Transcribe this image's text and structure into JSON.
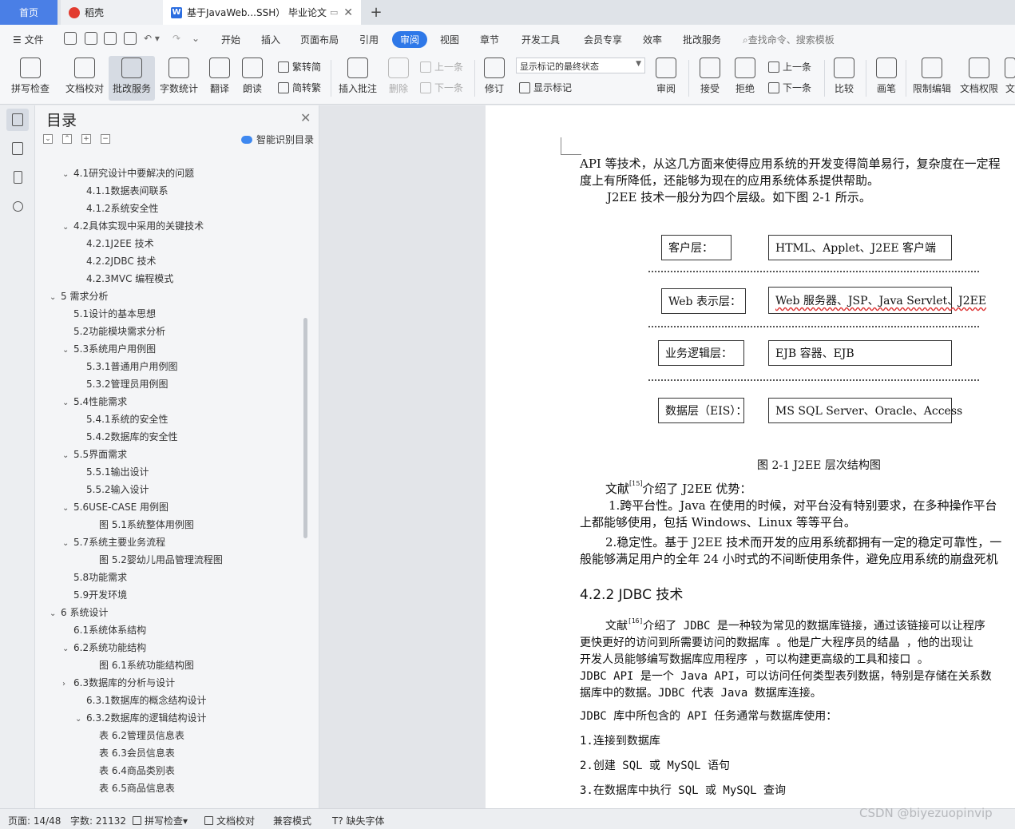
{
  "tabs": {
    "home": "首页",
    "daoke": "稻壳",
    "doc": "基于JavaWeb...SSH） 毕业论文",
    "add": "+"
  },
  "menu": {
    "file": "文件",
    "items": [
      "开始",
      "插入",
      "页面布局",
      "引用",
      "审阅",
      "视图",
      "章节",
      "开发工具",
      "会员专享",
      "效率",
      "批改服务"
    ],
    "active": "审阅",
    "search_placeholder": "查找命令、搜索模板"
  },
  "ribbon": {
    "spell": "拼写检查",
    "proof": "文档校对",
    "review_service": "批改服务",
    "word_count": "字数统计",
    "translate": "翻译",
    "read_aloud": "朗读",
    "trad": "繁转简",
    "simp": "简转繁",
    "insert_comment": "插入批注",
    "delete": "删除",
    "prev_comment": "上一条",
    "next_comment": "下一条",
    "revise": "修订",
    "markup_state": "显示标记的最终状态",
    "show_markup": "显示标记",
    "review": "审阅",
    "accept": "接受",
    "reject": "拒绝",
    "prev_change": "上一条",
    "next_change": "下一条",
    "compare": "比较",
    "pen": "画笔",
    "restrict": "限制编辑",
    "permission": "文档权限",
    "more": "文"
  },
  "toc": {
    "title": "目录",
    "smart": "智能识别目录",
    "items": [
      {
        "text": "4.1研究设计中要解决的问题",
        "level": 2,
        "caret": "expanded"
      },
      {
        "text": "4.1.1数据表间联系",
        "level": 3,
        "caret": ""
      },
      {
        "text": "4.1.2系统安全性",
        "level": 3,
        "caret": ""
      },
      {
        "text": "4.2具体实现中采用的关键技术",
        "level": 2,
        "caret": "expanded"
      },
      {
        "text": "4.2.1J2EE 技术",
        "level": 3,
        "caret": ""
      },
      {
        "text": "4.2.2JDBC 技术",
        "level": 3,
        "caret": ""
      },
      {
        "text": "4.2.3MVC 编程模式",
        "level": 3,
        "caret": ""
      },
      {
        "text": "5 需求分析",
        "level": 1,
        "caret": "expanded"
      },
      {
        "text": "5.1设计的基本思想",
        "level": 2,
        "caret": ""
      },
      {
        "text": "5.2功能模块需求分析",
        "level": 2,
        "caret": ""
      },
      {
        "text": "5.3系统用户用例图",
        "level": 2,
        "caret": "expanded"
      },
      {
        "text": "5.3.1普通用户用例图",
        "level": 3,
        "caret": ""
      },
      {
        "text": "5.3.2管理员用例图",
        "level": 3,
        "caret": ""
      },
      {
        "text": "5.4性能需求",
        "level": 2,
        "caret": "expanded"
      },
      {
        "text": "5.4.1系统的安全性",
        "level": 3,
        "caret": ""
      },
      {
        "text": "5.4.2数据库的安全性",
        "level": 3,
        "caret": ""
      },
      {
        "text": "5.5界面需求",
        "level": 2,
        "caret": "expanded"
      },
      {
        "text": "5.5.1输出设计",
        "level": 3,
        "caret": ""
      },
      {
        "text": "5.5.2输入设计",
        "level": 3,
        "caret": ""
      },
      {
        "text": "5.6USE-CASE 用例图",
        "level": 2,
        "caret": "expanded"
      },
      {
        "text": "图 5.1系统整体用例图",
        "level": 4,
        "caret": ""
      },
      {
        "text": "5.7系统主要业务流程",
        "level": 2,
        "caret": "expanded"
      },
      {
        "text": "图 5.2婴幼儿用品管理流程图",
        "level": 4,
        "caret": ""
      },
      {
        "text": "5.8功能需求",
        "level": 2,
        "caret": ""
      },
      {
        "text": "5.9开发环境",
        "level": 2,
        "caret": ""
      },
      {
        "text": "6 系统设计",
        "level": 1,
        "caret": "expanded"
      },
      {
        "text": "6.1系统体系结构",
        "level": 2,
        "caret": ""
      },
      {
        "text": "6.2系统功能结构",
        "level": 2,
        "caret": "expanded"
      },
      {
        "text": "图 6.1系统功能结构图",
        "level": 4,
        "caret": ""
      },
      {
        "text": "6.3数据库的分析与设计",
        "level": 2,
        "caret": "collapsed"
      },
      {
        "text": "6.3.1数据库的概念结构设计",
        "level": 3,
        "caret": ""
      },
      {
        "text": "6.3.2数据库的逻辑结构设计",
        "level": 3,
        "caret": "expanded"
      },
      {
        "text": "表 6.2管理员信息表",
        "level": 4,
        "caret": ""
      },
      {
        "text": "表 6.3会员信息表",
        "level": 4,
        "caret": ""
      },
      {
        "text": "表 6.4商品类别表",
        "level": 4,
        "caret": ""
      },
      {
        "text": "表 6.5商品信息表",
        "level": 4,
        "caret": ""
      }
    ]
  },
  "document": {
    "p1a": "API 等技术，从这几方面来使得应用系统的开发变得简单易行，复杂度在一定程",
    "p1b": "度上有所降低，还能够为现在的应用系统体系提供帮助。",
    "p2": "J2EE 技术一般分为四个层级。如下图 2-1 所示。",
    "diagram": {
      "layers": [
        {
          "label": "客户层：",
          "content": "HTML、Applet、J2EE 客户端"
        },
        {
          "label": "Web 表示层：",
          "content": "Web 服务器、JSP、Java Servlet、J2EE"
        },
        {
          "label": "业务逻辑层：",
          "content": "EJB 容器、EJB"
        },
        {
          "label": "数据层（EIS）：",
          "content": "MS SQL Server、Oracle、Access"
        }
      ],
      "caption": "图 2-1 J2EE 层次结构图"
    },
    "p3_pre": "文献",
    "p3_ref": "[15]",
    "p3_post": "介绍了 J2EE 优势：",
    "p4a": "1.跨平台性。Java 在使用的时候，对平台没有特别要求，在多种操作平台",
    "p4b": "上都能够使用，包括 Windows、Linux 等等平台。",
    "p5a": "2.稳定性。基于 J2EE 技术而开发的应用系统都拥有一定的稳定可靠性，一",
    "p5b": "般能够满足用户的全年 24 小时式的不间断使用条件，避免应用系统的崩盘死机",
    "heading": "4.2.2 JDBC 技术",
    "p6_pre": "文献",
    "p6_ref": "[16]",
    "p6_post": "介绍了 JDBC 是一种较为常见的数据库链接，通过该链接可以让程序",
    "p6b": "更快更好的访问到所需要访问的数据库 。他是广大程序员的结晶 ，他的出现让",
    "p6c": "开发人员能够编写数据库应用程序 ，可以构建更高级的工具和接口 。",
    "p7a": "JDBC API 是一个 Java API，可以访问任何类型表列数据，特别是存储在关系数",
    "p7b": "据库中的数据。JDBC 代表 Java 数据库连接。",
    "p8": "JDBC 库中所包含的 API 任务通常与数据库使用：",
    "list": [
      "1.连接到数据库",
      "2.创建 SQL 或 MySQL 语句",
      "3.在数据库中执行 SQL 或 MySQL 查询"
    ]
  },
  "status": {
    "page": "页面: 14/48",
    "words": "字数: 21132",
    "spell": "拼写检查",
    "proof": "文档校对",
    "compat": "兼容模式",
    "missing_font": "缺失字体"
  },
  "watermark": "CSDN @biyezuopinvip"
}
